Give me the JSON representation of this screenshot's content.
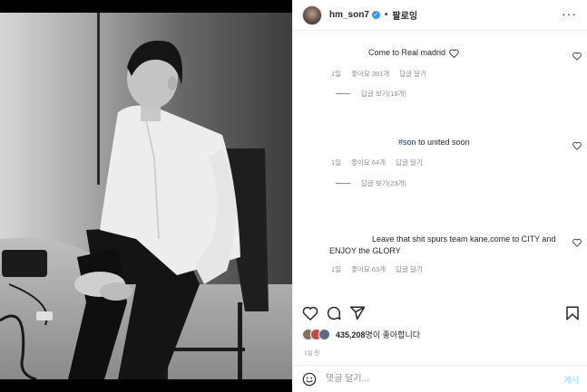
{
  "header": {
    "username": "hm_son7",
    "separator": "•",
    "follow_label": "팔로잉"
  },
  "comments": [
    {
      "text": "Come to Real madrid",
      "trailing_icon": "heart-outline",
      "age": "1일",
      "likes": "좋아요 391개",
      "reply_label": "답글 달기",
      "view_replies": "답글 보기(18개)"
    },
    {
      "hashtag": "#son",
      "text": " to united soon",
      "age": "1일",
      "likes": "좋아요 64개",
      "reply_label": "답글 달기",
      "view_replies": "답글 보기(23개)"
    },
    {
      "text_line1": "Leave that shit spurs team kane,come to CITY and",
      "text_line2": "ENJOY the GLORY",
      "age": "1일",
      "likes": "좋아요 63개",
      "reply_label": "답글 달기"
    }
  ],
  "actions": {
    "icons": [
      "heart-icon",
      "comment-icon",
      "share-icon",
      "bookmark-icon"
    ]
  },
  "likes": {
    "count": "435,208",
    "suffix": "명이 좋아합니다"
  },
  "time_ago": "1일 전",
  "comment_bar": {
    "placeholder": "댓글 달기...",
    "post_label": "게시"
  },
  "colors": {
    "accent": "#3897f0",
    "muted_text": "#8e8e8e",
    "post_disabled": "#b2dffc",
    "hashtag": "#00376b"
  }
}
